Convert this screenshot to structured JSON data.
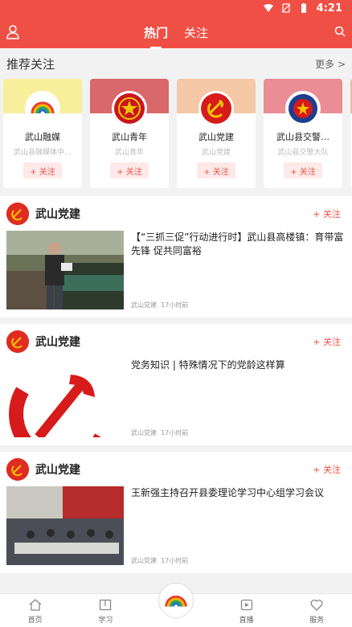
{
  "status_bar": {
    "time": "4:21"
  },
  "header": {
    "tabs": [
      {
        "label": "热门",
        "active": true
      },
      {
        "label": "关注",
        "active": false
      }
    ]
  },
  "recommend": {
    "title": "推荐关注",
    "more": "更多 >",
    "cards": [
      {
        "name": "武山融媒",
        "sub": "武山县融媒体中…",
        "follow": "+ 关注",
        "band_color": "#f7ef9c"
      },
      {
        "name": "武山青年",
        "sub": "武山青年",
        "follow": "+ 关注",
        "band_color": "#d9686a"
      },
      {
        "name": "武山党建",
        "sub": "武山党建",
        "follow": "+ 关注",
        "band_color": "#f5c8a7"
      },
      {
        "name": "武山县交警…",
        "sub": "武山县交警大队",
        "follow": "+ 关注",
        "band_color": "#ea8d94"
      }
    ]
  },
  "feed": [
    {
      "author": "武山党建",
      "follow": "+ 关注",
      "title": "【“三抓三促”行动进行时】武山县高楼镇：育带富先锋 促共同富裕",
      "source": "武山党建",
      "time": "17小时前"
    },
    {
      "author": "武山党建",
      "follow": "+ 关注",
      "title": "党务知识 | 特殊情况下的党龄这样算",
      "source": "武山党建",
      "time": "17小时前"
    },
    {
      "author": "武山党建",
      "follow": "+ 关注",
      "title": "王新强主持召开县委理论学习中心组学习会议",
      "source": "武山党建",
      "time": "17小时前"
    }
  ],
  "bottom_nav": {
    "items": [
      {
        "label": "首页"
      },
      {
        "label": "学习"
      },
      {
        "label": "直播"
      },
      {
        "label": "服务"
      }
    ]
  },
  "colors": {
    "brand_red": "#f04f45"
  }
}
